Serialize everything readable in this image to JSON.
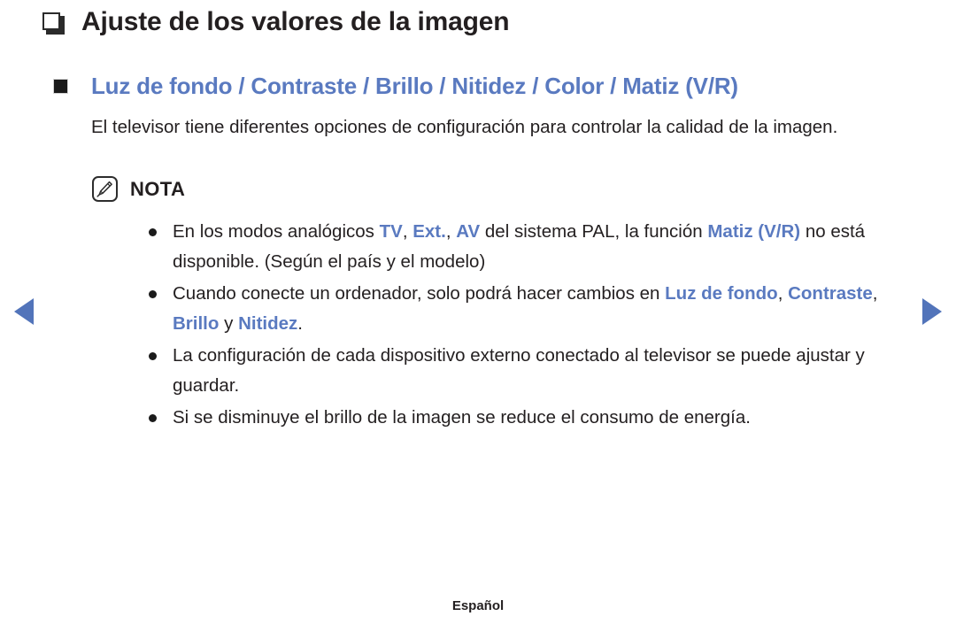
{
  "page": {
    "title": "Ajuste de los valores de la imagen",
    "title_icon": "book-icon",
    "subheading": "Luz de fondo / Contraste / Brillo / Nitidez / Color / Matiz (V/R)",
    "subheading_bullet_icon": "filled-square-bullet-icon",
    "paragraph": "El televisor tiene diferentes opciones de configuración para controlar la calidad de la imagen.",
    "accent_color": "#5a7ac0",
    "text_color": "#231f20"
  },
  "note": {
    "icon": "pencil-note-icon",
    "label": "NOTA",
    "items": [
      {
        "parts": [
          {
            "text": "En los modos analógicos ",
            "style": "normal"
          },
          {
            "text": "TV",
            "style": "accent"
          },
          {
            "text": ", ",
            "style": "normal"
          },
          {
            "text": "Ext.",
            "style": "accent"
          },
          {
            "text": ", ",
            "style": "normal"
          },
          {
            "text": "AV",
            "style": "accent"
          },
          {
            "text": " del sistema PAL, la función ",
            "style": "normal"
          },
          {
            "text": "Matiz (V/R)",
            "style": "accent"
          },
          {
            "text": " no está disponible. (Según el país y el modelo)",
            "style": "normal"
          }
        ]
      },
      {
        "parts": [
          {
            "text": "Cuando conecte un ordenador, solo podrá hacer cambios en ",
            "style": "normal"
          },
          {
            "text": "Luz de fondo",
            "style": "accent"
          },
          {
            "text": ", ",
            "style": "normal"
          },
          {
            "text": "Contraste",
            "style": "accent"
          },
          {
            "text": ", ",
            "style": "normal"
          },
          {
            "text": "Brillo",
            "style": "accent"
          },
          {
            "text": " y ",
            "style": "normal"
          },
          {
            "text": "Nitidez",
            "style": "accent"
          },
          {
            "text": ".",
            "style": "normal"
          }
        ]
      },
      {
        "parts": [
          {
            "text": "La configuración de cada dispositivo externo conectado al televisor se puede ajustar y guardar.",
            "style": "normal"
          }
        ]
      },
      {
        "parts": [
          {
            "text": "Si se disminuye el brillo de la imagen se reduce el consumo de energía.",
            "style": "normal"
          }
        ]
      }
    ]
  },
  "nav": {
    "prev_icon": "arrow-left-icon",
    "next_icon": "arrow-right-icon",
    "arrow_color": "#5274ba"
  },
  "footer": {
    "language": "Español"
  }
}
